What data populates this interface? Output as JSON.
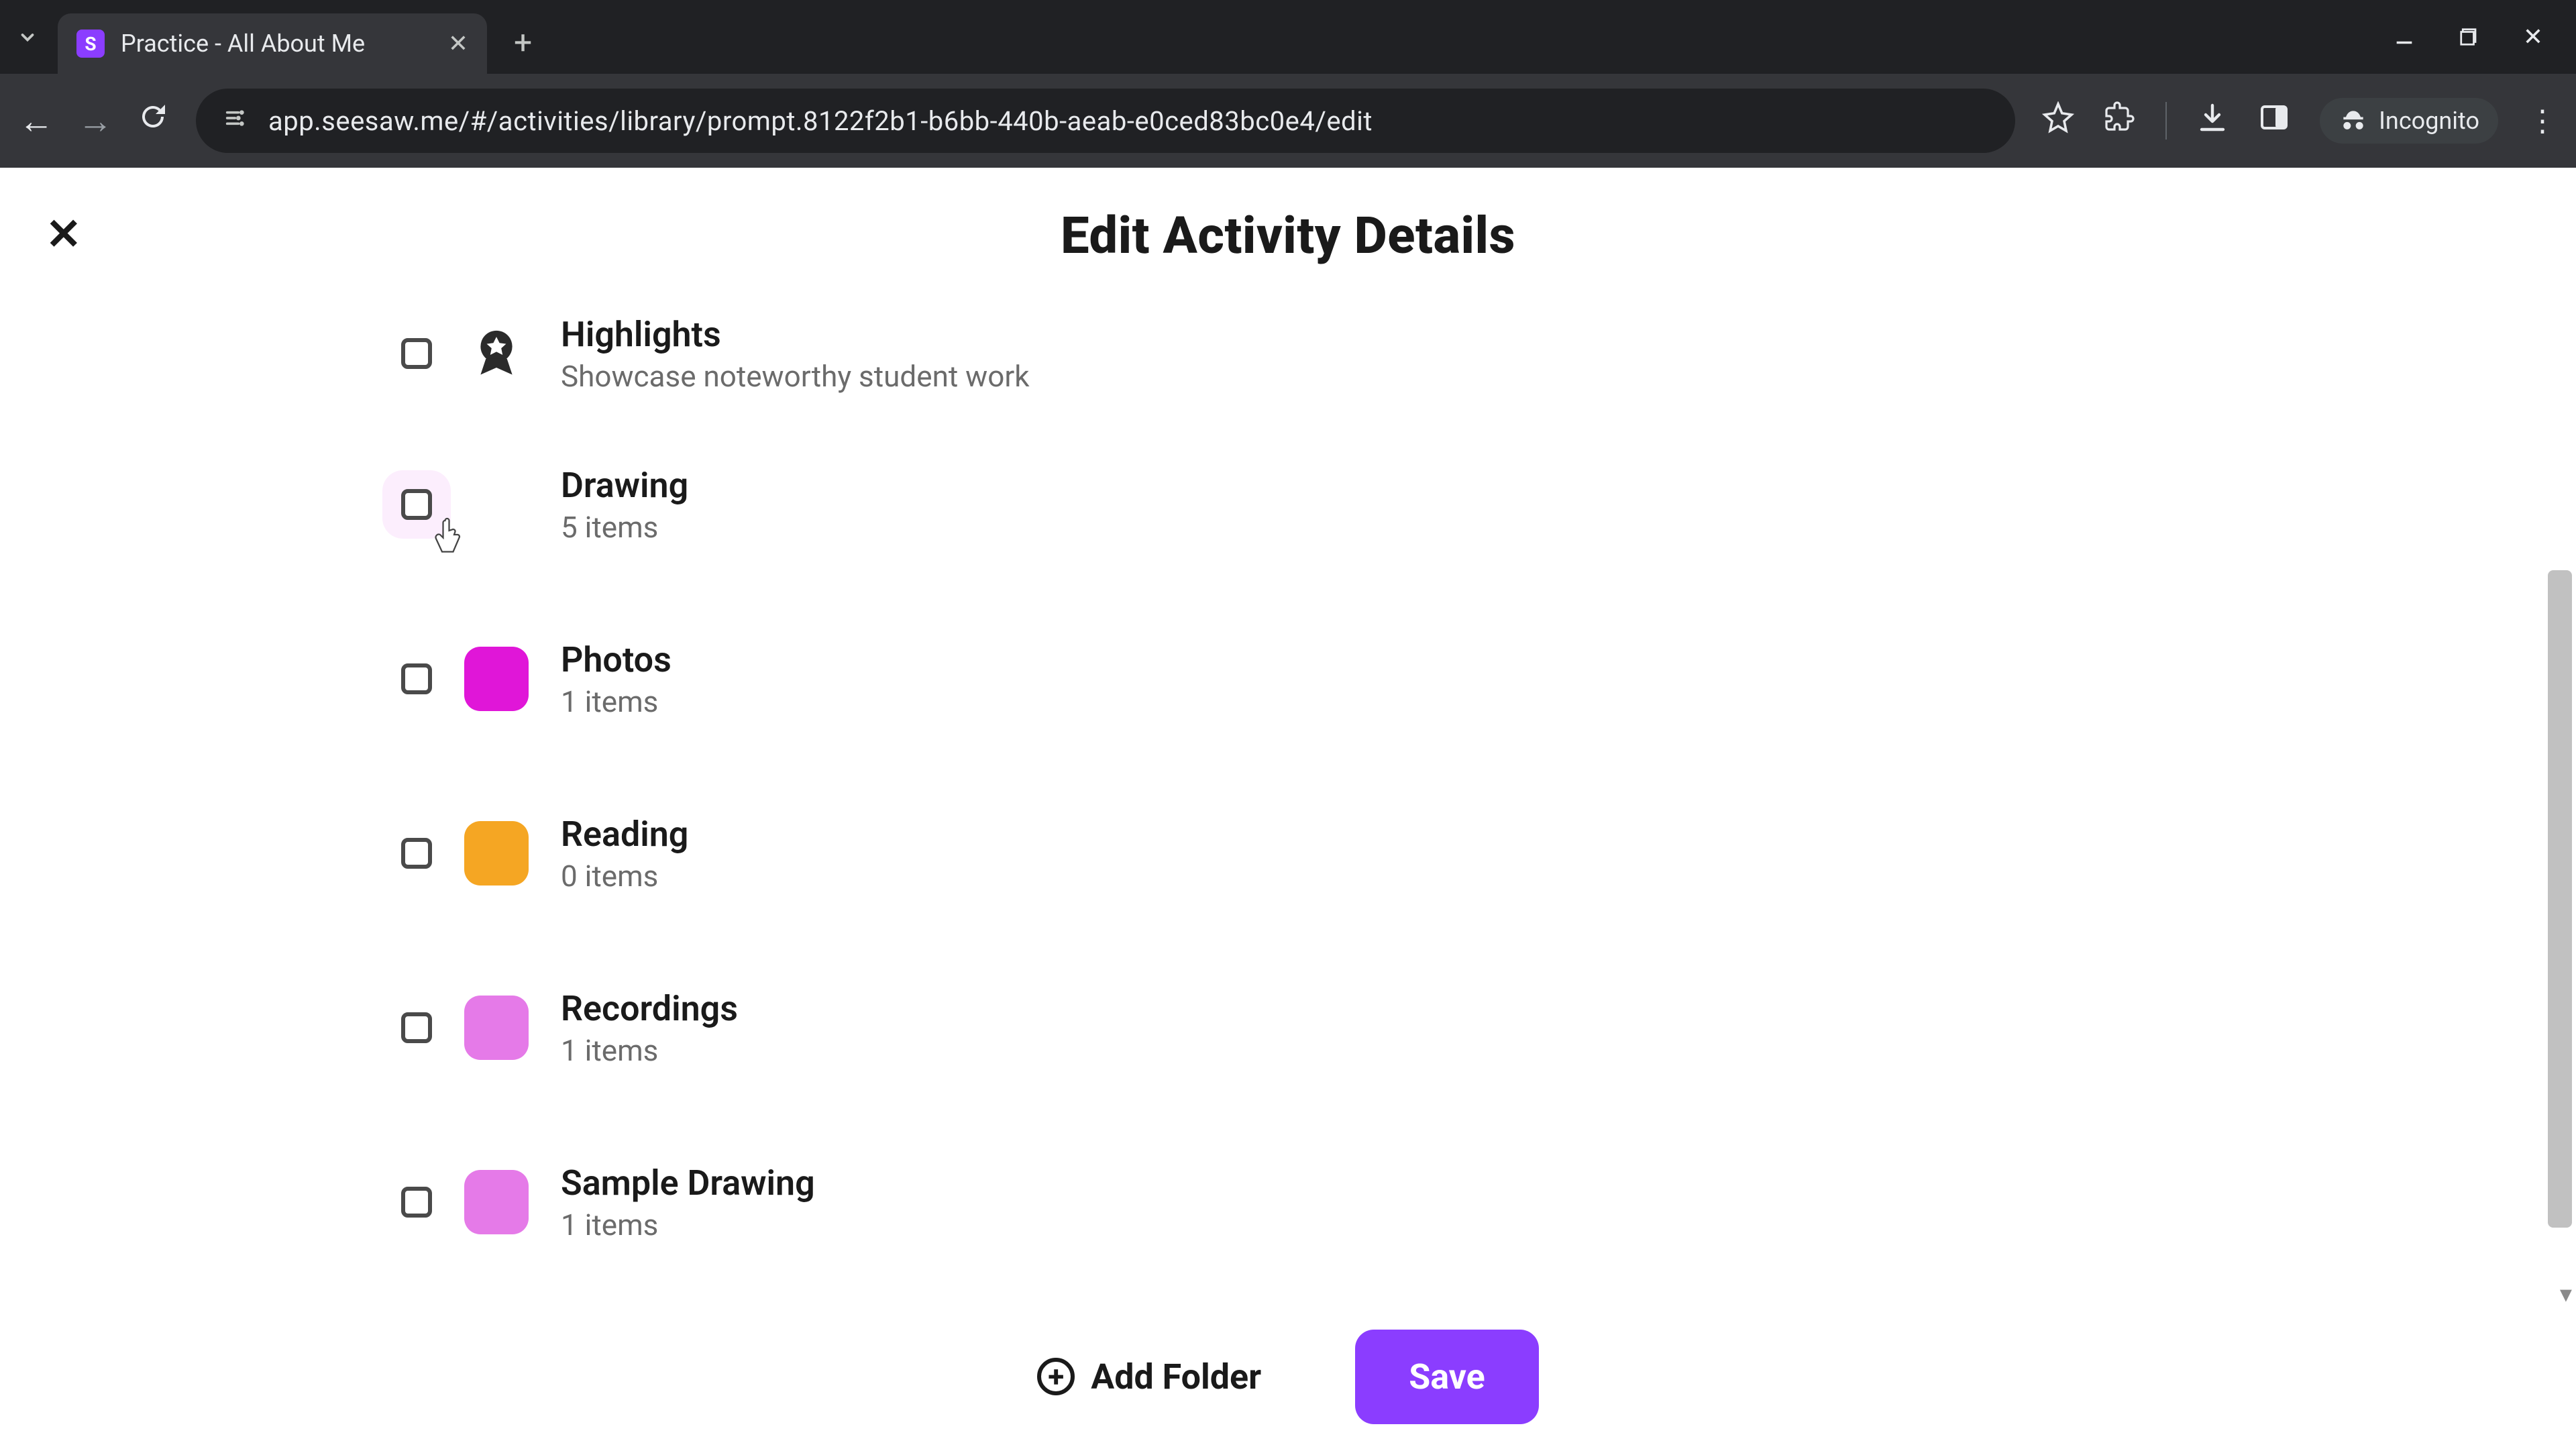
{
  "browser": {
    "tab_title": "Practice - All About Me",
    "tab_favicon_letter": "S",
    "url": "app.seesaw.me/#/activities/library/prompt.8122f2b1-b6bb-440b-aeab-e0ced83bc0e4/edit",
    "incognito_label": "Incognito"
  },
  "page": {
    "title": "Edit Activity Details",
    "folders": [
      {
        "name": "Highlights",
        "subtitle": "Showcase noteworthy student work",
        "icon_type": "highlights",
        "color": "#000000"
      },
      {
        "name": "Drawing",
        "subtitle": "5 items",
        "icon_type": "color",
        "color": "#E016D8"
      },
      {
        "name": "Photos",
        "subtitle": "1 items",
        "icon_type": "color",
        "color": "#E016D8"
      },
      {
        "name": "Reading",
        "subtitle": "0 items",
        "icon_type": "color",
        "color": "#F5A623"
      },
      {
        "name": "Recordings",
        "subtitle": "1 items",
        "icon_type": "color",
        "color": "#E57AE8"
      },
      {
        "name": "Sample Drawing",
        "subtitle": "1 items",
        "icon_type": "color",
        "color": "#E57AE8"
      }
    ],
    "add_folder_label": "Add Folder",
    "save_label": "Save"
  }
}
